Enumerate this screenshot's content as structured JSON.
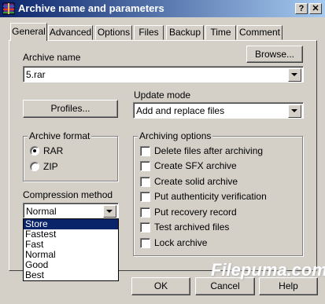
{
  "window": {
    "title": "Archive name and parameters",
    "help_btn": "?",
    "close_btn": "✕"
  },
  "tabs": [
    "General",
    "Advanced",
    "Options",
    "Files",
    "Backup",
    "Time",
    "Comment"
  ],
  "active_tab": "General",
  "archive_name": {
    "label": "Archive name",
    "value": "5.rar",
    "browse_label": "Browse..."
  },
  "profiles_label": "Profiles...",
  "update_mode": {
    "label": "Update mode",
    "value": "Add and replace files"
  },
  "archive_format": {
    "title": "Archive format",
    "options": [
      "RAR",
      "ZIP"
    ],
    "selected": "RAR"
  },
  "archiving_options": {
    "title": "Archiving options",
    "items": [
      "Delete files after archiving",
      "Create SFX archive",
      "Create solid archive",
      "Put authenticity verification",
      "Put recovery record",
      "Test archived files",
      "Lock archive"
    ]
  },
  "compression": {
    "label": "Compression method",
    "value": "Normal",
    "options": [
      "Store",
      "Fastest",
      "Fast",
      "Normal",
      "Good",
      "Best"
    ],
    "highlighted": "Store"
  },
  "buttons": {
    "ok": "OK",
    "cancel": "Cancel",
    "help": "Help"
  },
  "watermark": "Filepuma.com",
  "colors": {
    "dialog_bg": "#d4d0c8",
    "title_start": "#0a246a",
    "title_end": "#a6caf0",
    "selection": "#0a246a"
  }
}
